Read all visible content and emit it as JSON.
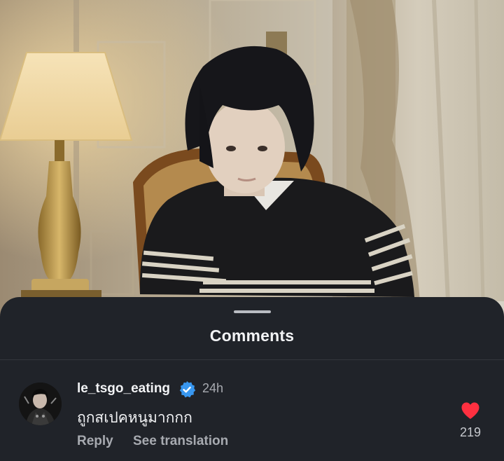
{
  "sheet": {
    "title": "Comments"
  },
  "comment": {
    "username": "le_tsgo_eating",
    "verified": true,
    "time": "24h",
    "text": "ถูกสเปคหนูมากกก",
    "reply_label": "Reply",
    "translate_label": "See translation",
    "like_count": "219",
    "liked": true
  },
  "colors": {
    "sheet_bg": "#202329",
    "verified_blue": "#3897f0",
    "heart_red": "#ff3040",
    "secondary_text": "#a7aab0"
  },
  "icons": {
    "verified": "verified-badge-icon",
    "like": "heart-icon"
  }
}
